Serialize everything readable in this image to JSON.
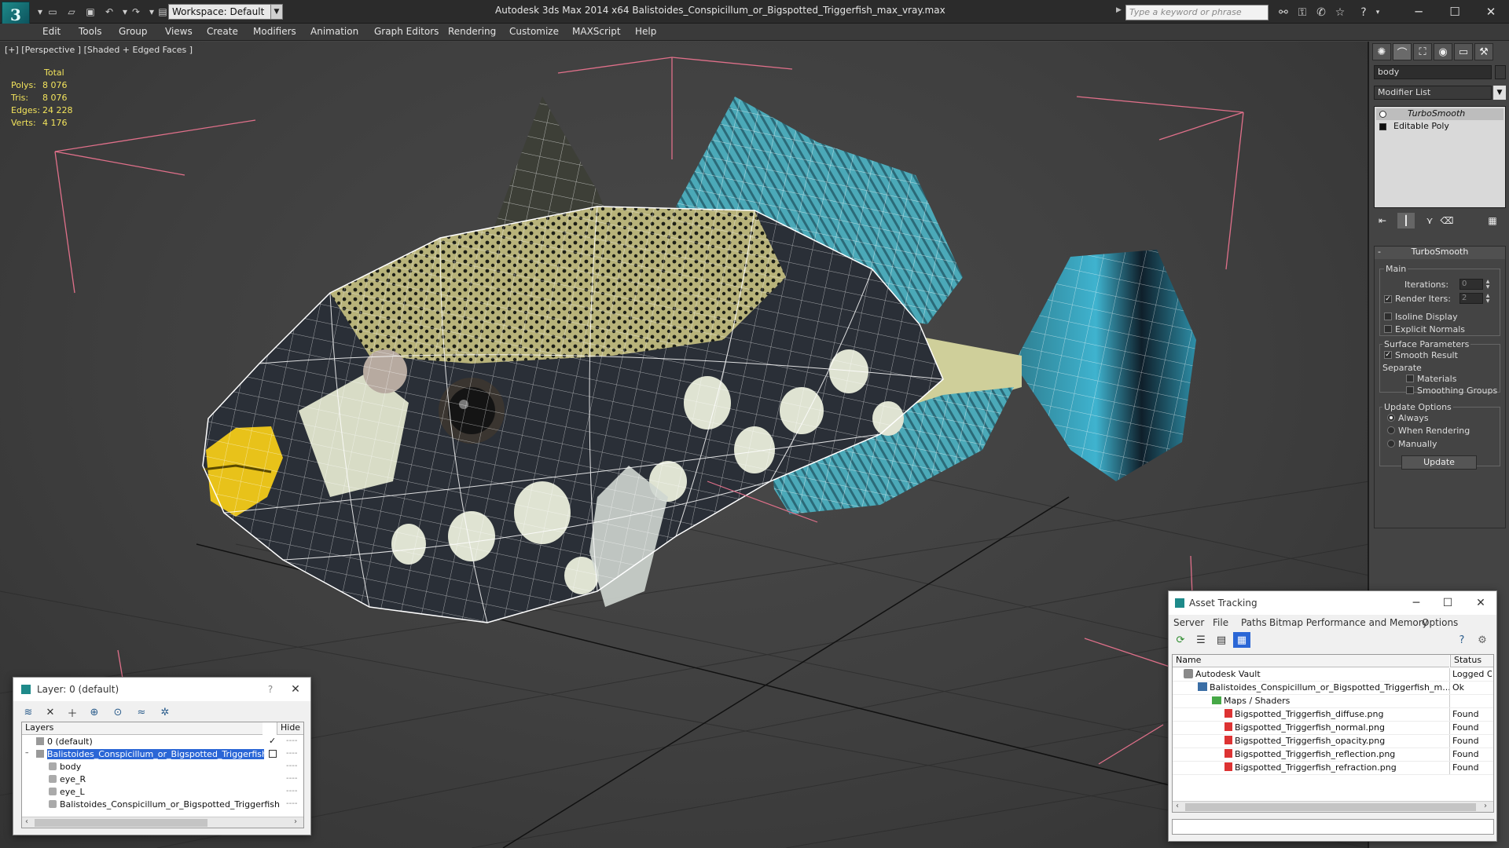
{
  "app": {
    "title": "Autodesk 3ds Max  2014 x64      Balistoides_Conspicillum_or_Bigspotted_Triggerfish_max_vray.max",
    "logo_letter": "3",
    "workspace": "Workspace: Default",
    "search_placeholder": "Type a keyword or phrase"
  },
  "menu": [
    "Edit",
    "Tools",
    "Group",
    "Views",
    "Create",
    "Modifiers",
    "Animation",
    "Graph Editors",
    "Rendering",
    "Customize",
    "MAXScript",
    "Help"
  ],
  "viewport": {
    "label": "[+] [Perspective ] [Shaded + Edged Faces ]",
    "stats_header": "Total",
    "stats": [
      {
        "key": "Polys:",
        "value": "8 076"
      },
      {
        "key": "Tris:",
        "value": "8 076"
      },
      {
        "key": "Edges:",
        "value": "24 228"
      },
      {
        "key": "Verts:",
        "value": "4 176"
      }
    ]
  },
  "command_panel": {
    "object_name": "body",
    "modifier_list": "Modifier List",
    "stack": [
      "TurboSmooth",
      "Editable Poly"
    ],
    "rollout_title": "TurboSmooth",
    "main_group": "Main",
    "iterations_label": "Iterations:",
    "iterations_value": "0",
    "render_iters_label": "Render Iters:",
    "render_iters_value": "2",
    "isoline_display": "Isoline Display",
    "explicit_normals": "Explicit Normals",
    "surface_params": "Surface Parameters",
    "smooth_result": "Smooth Result",
    "separate": "Separate",
    "materials": "Materials",
    "smoothing_groups": "Smoothing Groups",
    "update_options": "Update Options",
    "always": "Always",
    "when_rendering": "When Rendering",
    "manually": "Manually",
    "update_button": "Update"
  },
  "layer_dialog": {
    "title": "Layer: 0 (default)",
    "col_layers": "Layers",
    "col_hide": "Hide",
    "rows": [
      {
        "name": "0 (default)",
        "indent": 0
      },
      {
        "name": "Balistoides_Conspicillum_or_Bigspotted_Triggerfish",
        "indent": 0
      },
      {
        "name": "body",
        "indent": 1
      },
      {
        "name": "eye_R",
        "indent": 1
      },
      {
        "name": "eye_L",
        "indent": 1
      },
      {
        "name": "Balistoides_Conspicillum_or_Bigspotted_Triggerfish",
        "indent": 1
      }
    ]
  },
  "asset_dialog": {
    "title": "Asset Tracking",
    "menu": [
      "Server",
      "File",
      "Paths",
      "Bitmap Performance and Memory",
      "Options"
    ],
    "col_name": "Name",
    "col_status": "Status",
    "rows": [
      {
        "name": "Autodesk Vault",
        "status": "Logged O",
        "indent": 0,
        "icon": "vault"
      },
      {
        "name": "Balistoides_Conspicillum_or_Bigspotted_Triggerfish_m...",
        "status": "Ok",
        "indent": 1,
        "icon": "max"
      },
      {
        "name": "Maps / Shaders",
        "status": "",
        "indent": 2,
        "icon": "folder"
      },
      {
        "name": "Bigspotted_Triggerfish_diffuse.png",
        "status": "Found",
        "indent": 3,
        "icon": "png"
      },
      {
        "name": "Bigspotted_Triggerfish_normal.png",
        "status": "Found",
        "indent": 3,
        "icon": "png"
      },
      {
        "name": "Bigspotted_Triggerfish_opacity.png",
        "status": "Found",
        "indent": 3,
        "icon": "png"
      },
      {
        "name": "Bigspotted_Triggerfish_reflection.png",
        "status": "Found",
        "indent": 3,
        "icon": "png"
      },
      {
        "name": "Bigspotted_Triggerfish_refraction.png",
        "status": "Found",
        "indent": 3,
        "icon": "png"
      }
    ]
  },
  "colors": {
    "stats": "#f2e35c",
    "selection": "#2a66d6",
    "grid": "#2a2a2a",
    "gizmo": "#e0708a"
  }
}
